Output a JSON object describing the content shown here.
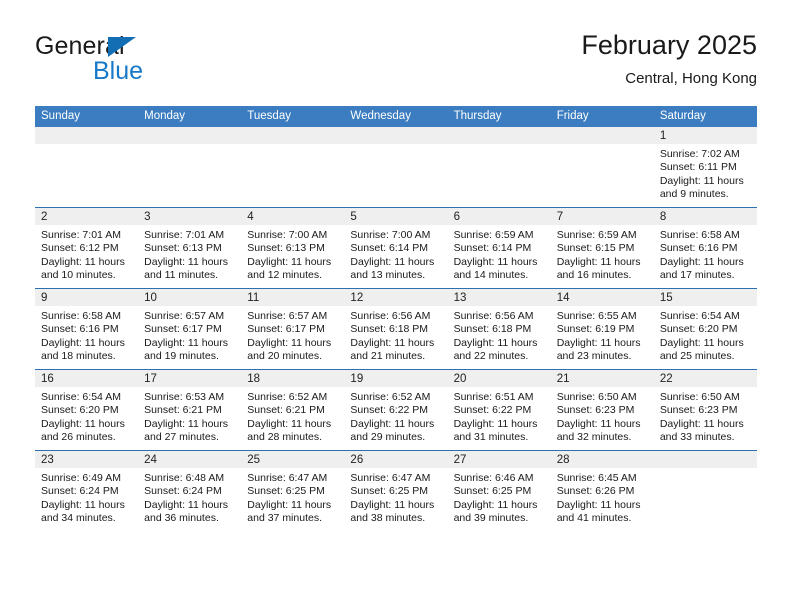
{
  "brand": {
    "name_part1": "General",
    "name_part2": "Blue",
    "accent_color": "#1878c8",
    "triangle_color": "#146eb4"
  },
  "header": {
    "title": "February 2025",
    "subtitle": "Central, Hong Kong"
  },
  "calendar": {
    "header_bg": "#3b7dc0",
    "header_text_color": "#ffffff",
    "row_separator_color": "#2f6fb0",
    "daynum_band_color": "#efefef",
    "weekdays": [
      "Sunday",
      "Monday",
      "Tuesday",
      "Wednesday",
      "Thursday",
      "Friday",
      "Saturday"
    ],
    "weeks": [
      [
        {
          "day": "",
          "empty": true
        },
        {
          "day": "",
          "empty": true
        },
        {
          "day": "",
          "empty": true
        },
        {
          "day": "",
          "empty": true
        },
        {
          "day": "",
          "empty": true
        },
        {
          "day": "",
          "empty": true
        },
        {
          "day": "1",
          "sunrise": "Sunrise: 7:02 AM",
          "sunset": "Sunset: 6:11 PM",
          "daylight": "Daylight: 11 hours and 9 minutes."
        }
      ],
      [
        {
          "day": "2",
          "sunrise": "Sunrise: 7:01 AM",
          "sunset": "Sunset: 6:12 PM",
          "daylight": "Daylight: 11 hours and 10 minutes."
        },
        {
          "day": "3",
          "sunrise": "Sunrise: 7:01 AM",
          "sunset": "Sunset: 6:13 PM",
          "daylight": "Daylight: 11 hours and 11 minutes."
        },
        {
          "day": "4",
          "sunrise": "Sunrise: 7:00 AM",
          "sunset": "Sunset: 6:13 PM",
          "daylight": "Daylight: 11 hours and 12 minutes."
        },
        {
          "day": "5",
          "sunrise": "Sunrise: 7:00 AM",
          "sunset": "Sunset: 6:14 PM",
          "daylight": "Daylight: 11 hours and 13 minutes."
        },
        {
          "day": "6",
          "sunrise": "Sunrise: 6:59 AM",
          "sunset": "Sunset: 6:14 PM",
          "daylight": "Daylight: 11 hours and 14 minutes."
        },
        {
          "day": "7",
          "sunrise": "Sunrise: 6:59 AM",
          "sunset": "Sunset: 6:15 PM",
          "daylight": "Daylight: 11 hours and 16 minutes."
        },
        {
          "day": "8",
          "sunrise": "Sunrise: 6:58 AM",
          "sunset": "Sunset: 6:16 PM",
          "daylight": "Daylight: 11 hours and 17 minutes."
        }
      ],
      [
        {
          "day": "9",
          "sunrise": "Sunrise: 6:58 AM",
          "sunset": "Sunset: 6:16 PM",
          "daylight": "Daylight: 11 hours and 18 minutes."
        },
        {
          "day": "10",
          "sunrise": "Sunrise: 6:57 AM",
          "sunset": "Sunset: 6:17 PM",
          "daylight": "Daylight: 11 hours and 19 minutes."
        },
        {
          "day": "11",
          "sunrise": "Sunrise: 6:57 AM",
          "sunset": "Sunset: 6:17 PM",
          "daylight": "Daylight: 11 hours and 20 minutes."
        },
        {
          "day": "12",
          "sunrise": "Sunrise: 6:56 AM",
          "sunset": "Sunset: 6:18 PM",
          "daylight": "Daylight: 11 hours and 21 minutes."
        },
        {
          "day": "13",
          "sunrise": "Sunrise: 6:56 AM",
          "sunset": "Sunset: 6:18 PM",
          "daylight": "Daylight: 11 hours and 22 minutes."
        },
        {
          "day": "14",
          "sunrise": "Sunrise: 6:55 AM",
          "sunset": "Sunset: 6:19 PM",
          "daylight": "Daylight: 11 hours and 23 minutes."
        },
        {
          "day": "15",
          "sunrise": "Sunrise: 6:54 AM",
          "sunset": "Sunset: 6:20 PM",
          "daylight": "Daylight: 11 hours and 25 minutes."
        }
      ],
      [
        {
          "day": "16",
          "sunrise": "Sunrise: 6:54 AM",
          "sunset": "Sunset: 6:20 PM",
          "daylight": "Daylight: 11 hours and 26 minutes."
        },
        {
          "day": "17",
          "sunrise": "Sunrise: 6:53 AM",
          "sunset": "Sunset: 6:21 PM",
          "daylight": "Daylight: 11 hours and 27 minutes."
        },
        {
          "day": "18",
          "sunrise": "Sunrise: 6:52 AM",
          "sunset": "Sunset: 6:21 PM",
          "daylight": "Daylight: 11 hours and 28 minutes."
        },
        {
          "day": "19",
          "sunrise": "Sunrise: 6:52 AM",
          "sunset": "Sunset: 6:22 PM",
          "daylight": "Daylight: 11 hours and 29 minutes."
        },
        {
          "day": "20",
          "sunrise": "Sunrise: 6:51 AM",
          "sunset": "Sunset: 6:22 PM",
          "daylight": "Daylight: 11 hours and 31 minutes."
        },
        {
          "day": "21",
          "sunrise": "Sunrise: 6:50 AM",
          "sunset": "Sunset: 6:23 PM",
          "daylight": "Daylight: 11 hours and 32 minutes."
        },
        {
          "day": "22",
          "sunrise": "Sunrise: 6:50 AM",
          "sunset": "Sunset: 6:23 PM",
          "daylight": "Daylight: 11 hours and 33 minutes."
        }
      ],
      [
        {
          "day": "23",
          "sunrise": "Sunrise: 6:49 AM",
          "sunset": "Sunset: 6:24 PM",
          "daylight": "Daylight: 11 hours and 34 minutes."
        },
        {
          "day": "24",
          "sunrise": "Sunrise: 6:48 AM",
          "sunset": "Sunset: 6:24 PM",
          "daylight": "Daylight: 11 hours and 36 minutes."
        },
        {
          "day": "25",
          "sunrise": "Sunrise: 6:47 AM",
          "sunset": "Sunset: 6:25 PM",
          "daylight": "Daylight: 11 hours and 37 minutes."
        },
        {
          "day": "26",
          "sunrise": "Sunrise: 6:47 AM",
          "sunset": "Sunset: 6:25 PM",
          "daylight": "Daylight: 11 hours and 38 minutes."
        },
        {
          "day": "27",
          "sunrise": "Sunrise: 6:46 AM",
          "sunset": "Sunset: 6:25 PM",
          "daylight": "Daylight: 11 hours and 39 minutes."
        },
        {
          "day": "28",
          "sunrise": "Sunrise: 6:45 AM",
          "sunset": "Sunset: 6:26 PM",
          "daylight": "Daylight: 11 hours and 41 minutes."
        },
        {
          "day": "",
          "empty": true
        }
      ]
    ]
  }
}
